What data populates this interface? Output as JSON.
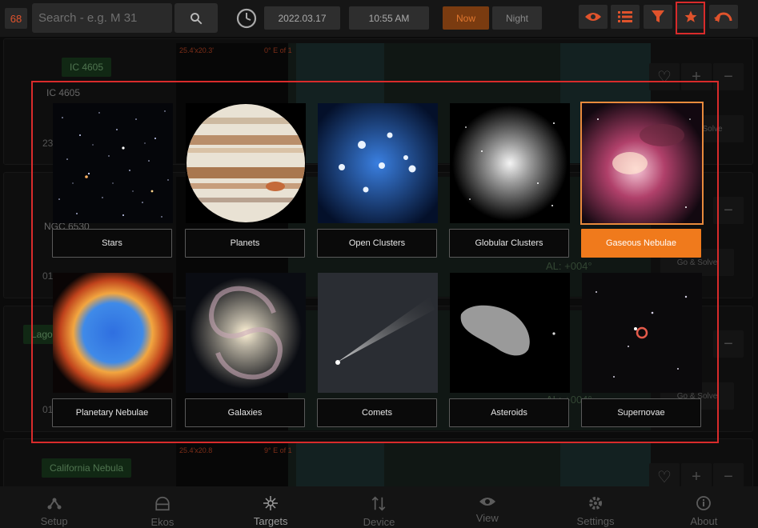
{
  "topbar": {
    "counter": "68",
    "search_placeholder": "Search - e.g. M 31",
    "date": "2022.03.17",
    "time": "10:55 AM",
    "now_label": "Now",
    "night_label": "Night"
  },
  "colors": {
    "accent": "#f07a1c",
    "highlight": "#d92b2b",
    "tag_green": "#1f4a26"
  },
  "background_list": {
    "card1": {
      "tag": "IC 4605",
      "name": "IC 4605",
      "field": "25.4'x20.3'",
      "offset": "0° E of 1",
      "time_partial": "23",
      "num": "87"
    },
    "card2": {
      "name": "NGC 6530",
      "time_partial": "01",
      "al": "AL: +004°",
      "go_solve": "Go & Solve",
      "field": "25.4'"
    },
    "card3": {
      "tag": "Lagoo",
      "al": "AL: +004°",
      "go_solve": "Go & Solve",
      "time_partial": "01"
    },
    "card4": {
      "tag": "California Nebula",
      "field": "25.4'x20.8",
      "offset": "9° E of 1"
    },
    "solve": "Solve"
  },
  "categories": [
    {
      "label": "Stars",
      "icon": "stars-image"
    },
    {
      "label": "Planets",
      "icon": "jupiter-image"
    },
    {
      "label": "Open Clusters",
      "icon": "pleiades-image"
    },
    {
      "label": "Globular Clusters",
      "icon": "globular-cluster-image"
    },
    {
      "label": "Gaseous Nebulae",
      "icon": "orion-nebula-image",
      "selected": true
    },
    {
      "label": "Planetary Nebulae",
      "icon": "helix-nebula-image"
    },
    {
      "label": "Galaxies",
      "icon": "whirlpool-galaxy-image"
    },
    {
      "label": "Comets",
      "icon": "comet-image"
    },
    {
      "label": "Asteroids",
      "icon": "asteroid-image"
    },
    {
      "label": "Supernovae",
      "icon": "supernova-remnant-image"
    }
  ],
  "bottomnav": [
    {
      "label": "Setup",
      "icon": "setup-icon"
    },
    {
      "label": "Ekos",
      "icon": "observatory-icon"
    },
    {
      "label": "Targets",
      "icon": "targets-icon",
      "active": true
    },
    {
      "label": "Device",
      "icon": "device-icon"
    },
    {
      "label": "View",
      "icon": "eye-icon"
    },
    {
      "label": "Settings",
      "icon": "gear-icon"
    },
    {
      "label": "About",
      "icon": "info-icon"
    }
  ]
}
